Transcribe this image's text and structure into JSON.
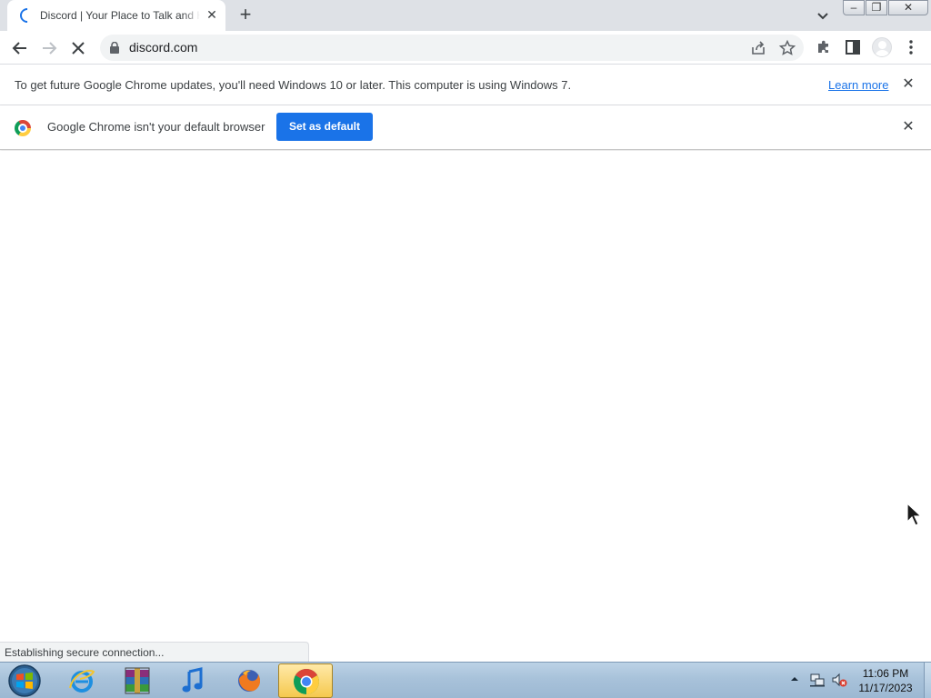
{
  "tab": {
    "title": "Discord | Your Place to Talk and Hang Out",
    "close_glyph": "✕",
    "new_tab_glyph": "+"
  },
  "window_controls": {
    "minimize_glyph": "–",
    "restore_glyph": "❐",
    "close_glyph": "✕"
  },
  "toolbar": {
    "url": "discord.com"
  },
  "infobar_update": {
    "message": "To get future Google Chrome updates, you'll need Windows 10 or later. This computer is using Windows 7.",
    "link_label": "Learn more",
    "close_glyph": "✕"
  },
  "infobar_default": {
    "message": "Google Chrome isn't your default browser",
    "button_label": "Set as default",
    "close_glyph": "✕"
  },
  "status_bubble": {
    "text": "Establishing secure connection..."
  },
  "taskbar": {
    "items": [
      {
        "name": "internet-explorer-icon"
      },
      {
        "name": "winrar-icon"
      },
      {
        "name": "itunes-icon"
      },
      {
        "name": "firefox-icon"
      },
      {
        "name": "chrome-icon",
        "active": true
      }
    ],
    "clock": {
      "time": "11:06 PM",
      "date": "11/17/2023"
    }
  },
  "colors": {
    "accent": "#1a73e8",
    "tabstrip": "#dee1e6",
    "omnibox": "#f1f3f4",
    "taskbar": "#a8c2da"
  }
}
